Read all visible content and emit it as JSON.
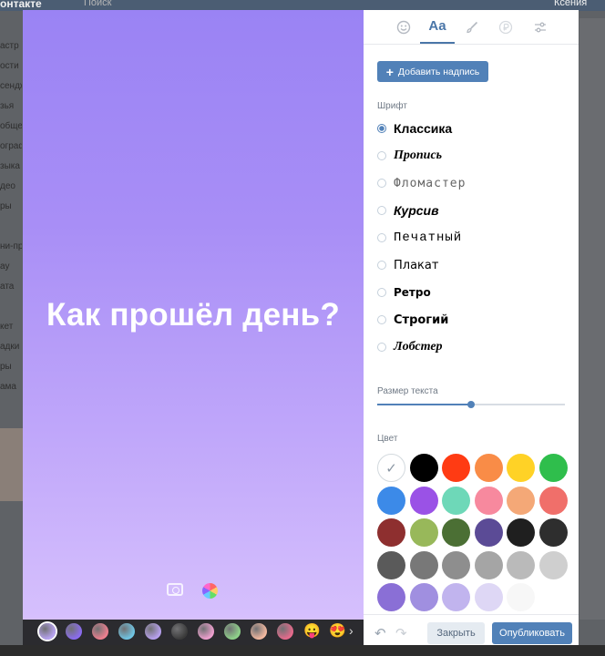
{
  "background": {
    "logo": "онтакте",
    "search": "Поиск",
    "user": "Ксения",
    "side_items": [
      "астр",
      "ости",
      "сендж",
      "зья",
      "обще",
      "ограф",
      "зыка",
      "део",
      "ры",
      "",
      "ни-при",
      "ay",
      "ата",
      "",
      "кет",
      "адки",
      "ры",
      "ама"
    ]
  },
  "canvas": {
    "text": "Как прошёл день?",
    "camera_icon": "camera-icon",
    "palette_icon": "color-wheel-icon"
  },
  "strip": {
    "swatches": [
      "#b9a4f4",
      "#8b6cf2",
      "#ef7f8f",
      "#6fc6e5",
      "#b8a1f0",
      "#3a3a3a",
      "#f0a0d0",
      "#8fd38a",
      "#f4b9a0",
      "#e86a8c"
    ],
    "emojis": [
      "😛",
      "😍"
    ]
  },
  "panel": {
    "tabs": [
      {
        "icon": "smiley-icon"
      },
      {
        "label": "Aa"
      },
      {
        "icon": "brush-icon"
      },
      {
        "icon": "currency-icon"
      },
      {
        "icon": "sliders-icon"
      }
    ],
    "add_label": "Добавить надпись",
    "font_title": "Шрифт",
    "fonts": [
      "Классика",
      "Пропись",
      "Фломастер",
      "Курсив",
      "Печатный",
      "Плакат",
      "Ретро",
      "Строгий",
      "Лобстер"
    ],
    "size_title": "Размер текста",
    "size_level": 0.5,
    "color_title": "Цвет",
    "colors": [
      "#ffffff",
      "#000000",
      "#ff3b13",
      "#f98c47",
      "#ffd226",
      "#2fbe4c",
      "#3c8ae8",
      "#9a52e6",
      "#6ed8b8",
      "#f7899e",
      "#f4a877",
      "#f06f6a",
      "#8e2f2f",
      "#98b85a",
      "#4b6f34",
      "#5b4b96",
      "#1f1f1f",
      "#2e2e2e",
      "#5a5a5a",
      "#787878",
      "#8e8e8e",
      "#a5a5a5",
      "#bababa",
      "#cfcfcf",
      "#8a6fd6",
      "#a08fe0",
      "#c1b4ee",
      "#ded7f5",
      "#f7f7f7"
    ],
    "close_label": "Закрыть",
    "publish_label": "Опубликовать"
  }
}
